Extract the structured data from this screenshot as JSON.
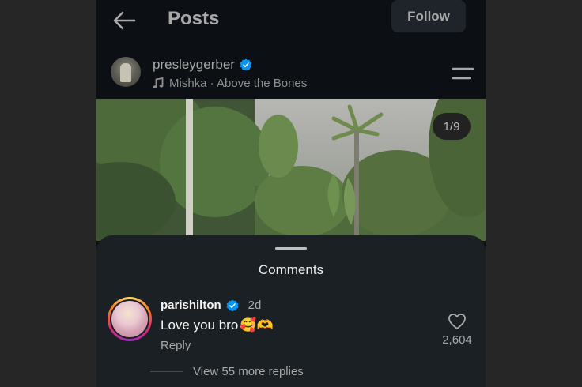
{
  "header": {
    "title": "Posts",
    "follow_label": "Follow"
  },
  "post": {
    "username": "presleygerber",
    "verified": true,
    "music": "Mishka · Above the Bones",
    "image_counter": "1/9"
  },
  "comments_sheet": {
    "title": "Comments",
    "comments": [
      {
        "username": "parishilton",
        "verified": true,
        "time": "2d",
        "text": "Love you bro",
        "emojis": "🥰🫶",
        "reply_label": "Reply",
        "likes": "2,604",
        "view_replies": "View 55 more replies"
      }
    ]
  },
  "colors": {
    "background": "#0c1014",
    "sheet": "#1b2024",
    "verified": "#0095f6",
    "follow_button": "#1e2429"
  },
  "icons": [
    "back-arrow-icon",
    "verified-badge-icon",
    "music-note-icon",
    "menu-icon",
    "heart-icon"
  ]
}
